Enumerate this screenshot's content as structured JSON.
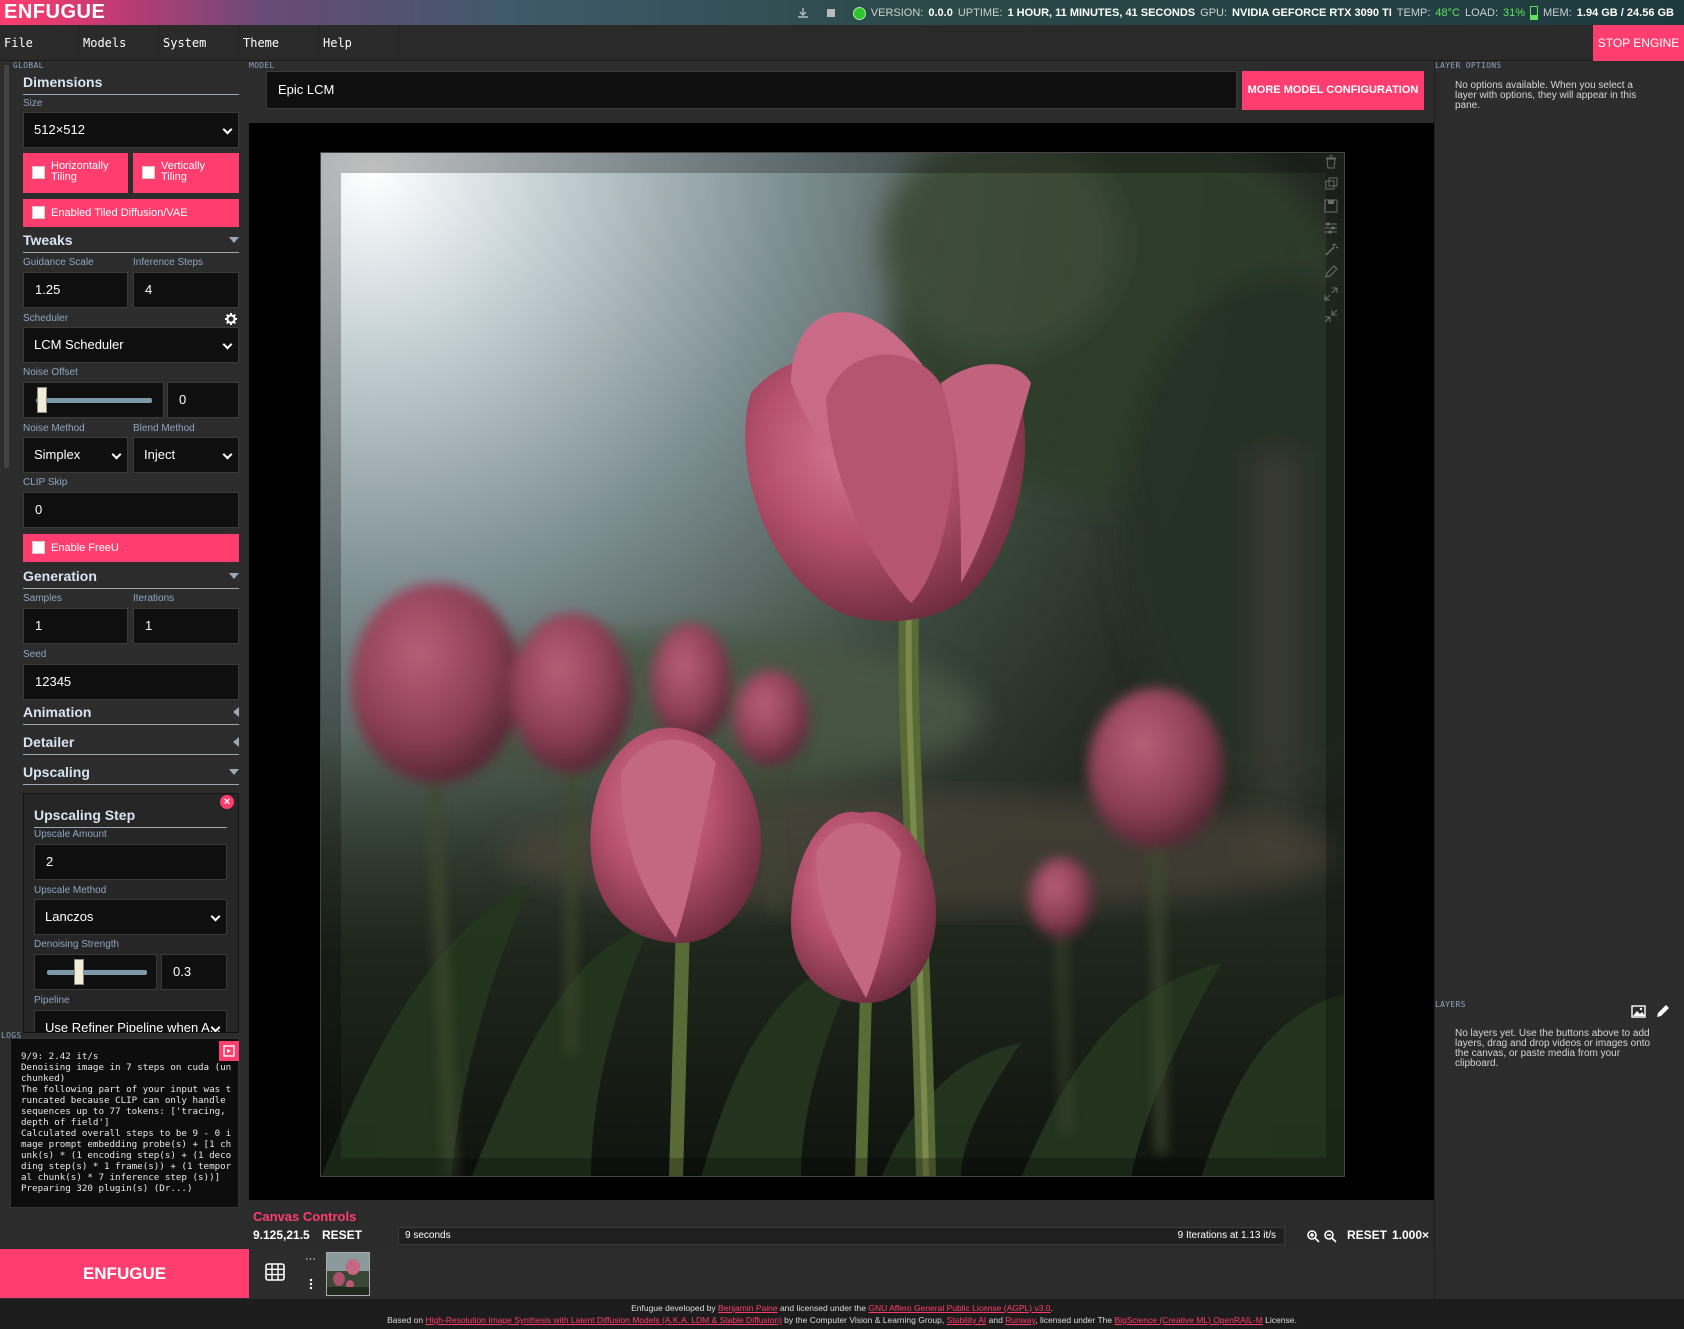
{
  "app": {
    "logo": "ENFUGUE"
  },
  "status": {
    "version_label": "VERSION:",
    "version": "0.0.0",
    "uptime_label": "UPTIME:",
    "uptime": "1 HOUR, 11 MINUTES, 41 SECONDS",
    "gpu_label": "GPU:",
    "gpu": "NVIDIA GEFORCE RTX 3090 TI",
    "temp_label": "TEMP:",
    "temp": "48°C",
    "load_label": "LOAD:",
    "load": "31%",
    "load_fraction": 0.31,
    "mem_label": "MEM:",
    "mem": "1.94 GB / 24.56 GB",
    "mem_fraction": 0.08,
    "engine_status_color": "#2ec52e"
  },
  "menu": {
    "items": [
      "File",
      "Models",
      "System",
      "Theme",
      "Help"
    ],
    "stop_engine": "STOP ENGINE"
  },
  "left": {
    "global_tag": "GLOBAL",
    "dimensions": {
      "title": "Dimensions",
      "size_label": "Size",
      "size_value": "512×512",
      "horizontal_tiling": "Horizontally Tiling",
      "vertical_tiling": "Vertically Tiling",
      "tiled_diffusion": "Enabled Tiled Diffusion/VAE"
    },
    "tweaks": {
      "title": "Tweaks",
      "guidance_label": "Guidance Scale",
      "guidance_value": "1.25",
      "steps_label": "Inference Steps",
      "steps_value": "4",
      "scheduler_label": "Scheduler",
      "scheduler_value": "LCM Scheduler",
      "noise_offset_label": "Noise Offset",
      "noise_offset_value": "0",
      "noise_method_label": "Noise Method",
      "noise_method_value": "Simplex",
      "blend_method_label": "Blend Method",
      "blend_method_value": "Inject",
      "clip_skip_label": "CLIP Skip",
      "clip_skip_value": "0",
      "freeu": "Enable FreeU"
    },
    "generation": {
      "title": "Generation",
      "samples_label": "Samples",
      "samples_value": "1",
      "iterations_label": "Iterations",
      "iterations_value": "1",
      "seed_label": "Seed",
      "seed_value": "12345"
    },
    "animation": {
      "title": "Animation"
    },
    "detailer": {
      "title": "Detailer"
    },
    "upscaling": {
      "title": "Upscaling",
      "step_title": "Upscaling Step",
      "amount_label": "Upscale Amount",
      "amount_value": "2",
      "method_label": "Upscale Method",
      "method_value": "Lanczos",
      "denoise_label": "Denoising Strength",
      "denoise_value": "0.3",
      "pipeline_label": "Pipeline",
      "pipeline_value": "Use Refiner Pipeline when A..."
    },
    "logs": {
      "tag": "LOGS",
      "text": "9/9: 2.42 it/s\nDenoising image in 7 steps on cuda (unchunked)\nThe following part of your input was truncated because CLIP can only handle sequences up to 77 tokens: ['tracing, depth of field']\nCalculated overall steps to be 9 - 0 image prompt embedding probe(s) + [1 chunk(s) * (1 encoding step(s) + (1 decoding step(s) * 1 frame(s)) + (1 temporal chunk(s) * 7 inference step (s))]\nPreparing 320 plugin(s) (Dr...)"
    },
    "enfugue_button": "ENFUGUE"
  },
  "center": {
    "model_tag": "MODEL",
    "model_value": "Epic LCM",
    "more_model_button": "MORE MODEL CONFIGURATION",
    "canvas_controls_title": "Canvas Controls",
    "coordinates": "9.125,21.5",
    "reset_label": "RESET",
    "elapsed": "9 seconds",
    "rate": "9 Iterations at 1.13 it/s",
    "zoom_reset_label": "RESET",
    "zoom_level": "1.000×"
  },
  "right": {
    "layer_options_tag": "LAYER OPTIONS",
    "layer_options_note": "No options available. When you select a layer with options, they will appear in this pane.",
    "layers_tag": "LAYERS",
    "layers_note": "No layers yet. Use the buttons above to add layers, drag and drop videos or images onto the canvas, or paste media from your clipboard."
  },
  "footer": {
    "line1_prefix": "Enfugue developed by ",
    "author": "Benjamin Paine",
    "line1_mid": " and licensed under the ",
    "license": "GNU Affero General Public License (AGPL) v3.0",
    "line1_end": ".",
    "line2_prefix": "Based on ",
    "paper": "High-Resolution Image Synthesis with Latent Diffusion Models (A.K.A. LDM & Stable Diffusion)",
    "line2_mid": " by the Computer Vision & Learning Group, ",
    "stability": "Stability AI",
    "line2_and": " and ",
    "runway": "Runway",
    "line2_lic": ", licensed under The ",
    "openrail": "BigScience (Creative ML) OpenRAIL-M",
    "line2_end": " License."
  },
  "colors": {
    "accent": "#ff3d6e",
    "label": "#8da6c4",
    "panel": "#2c2c2c"
  }
}
